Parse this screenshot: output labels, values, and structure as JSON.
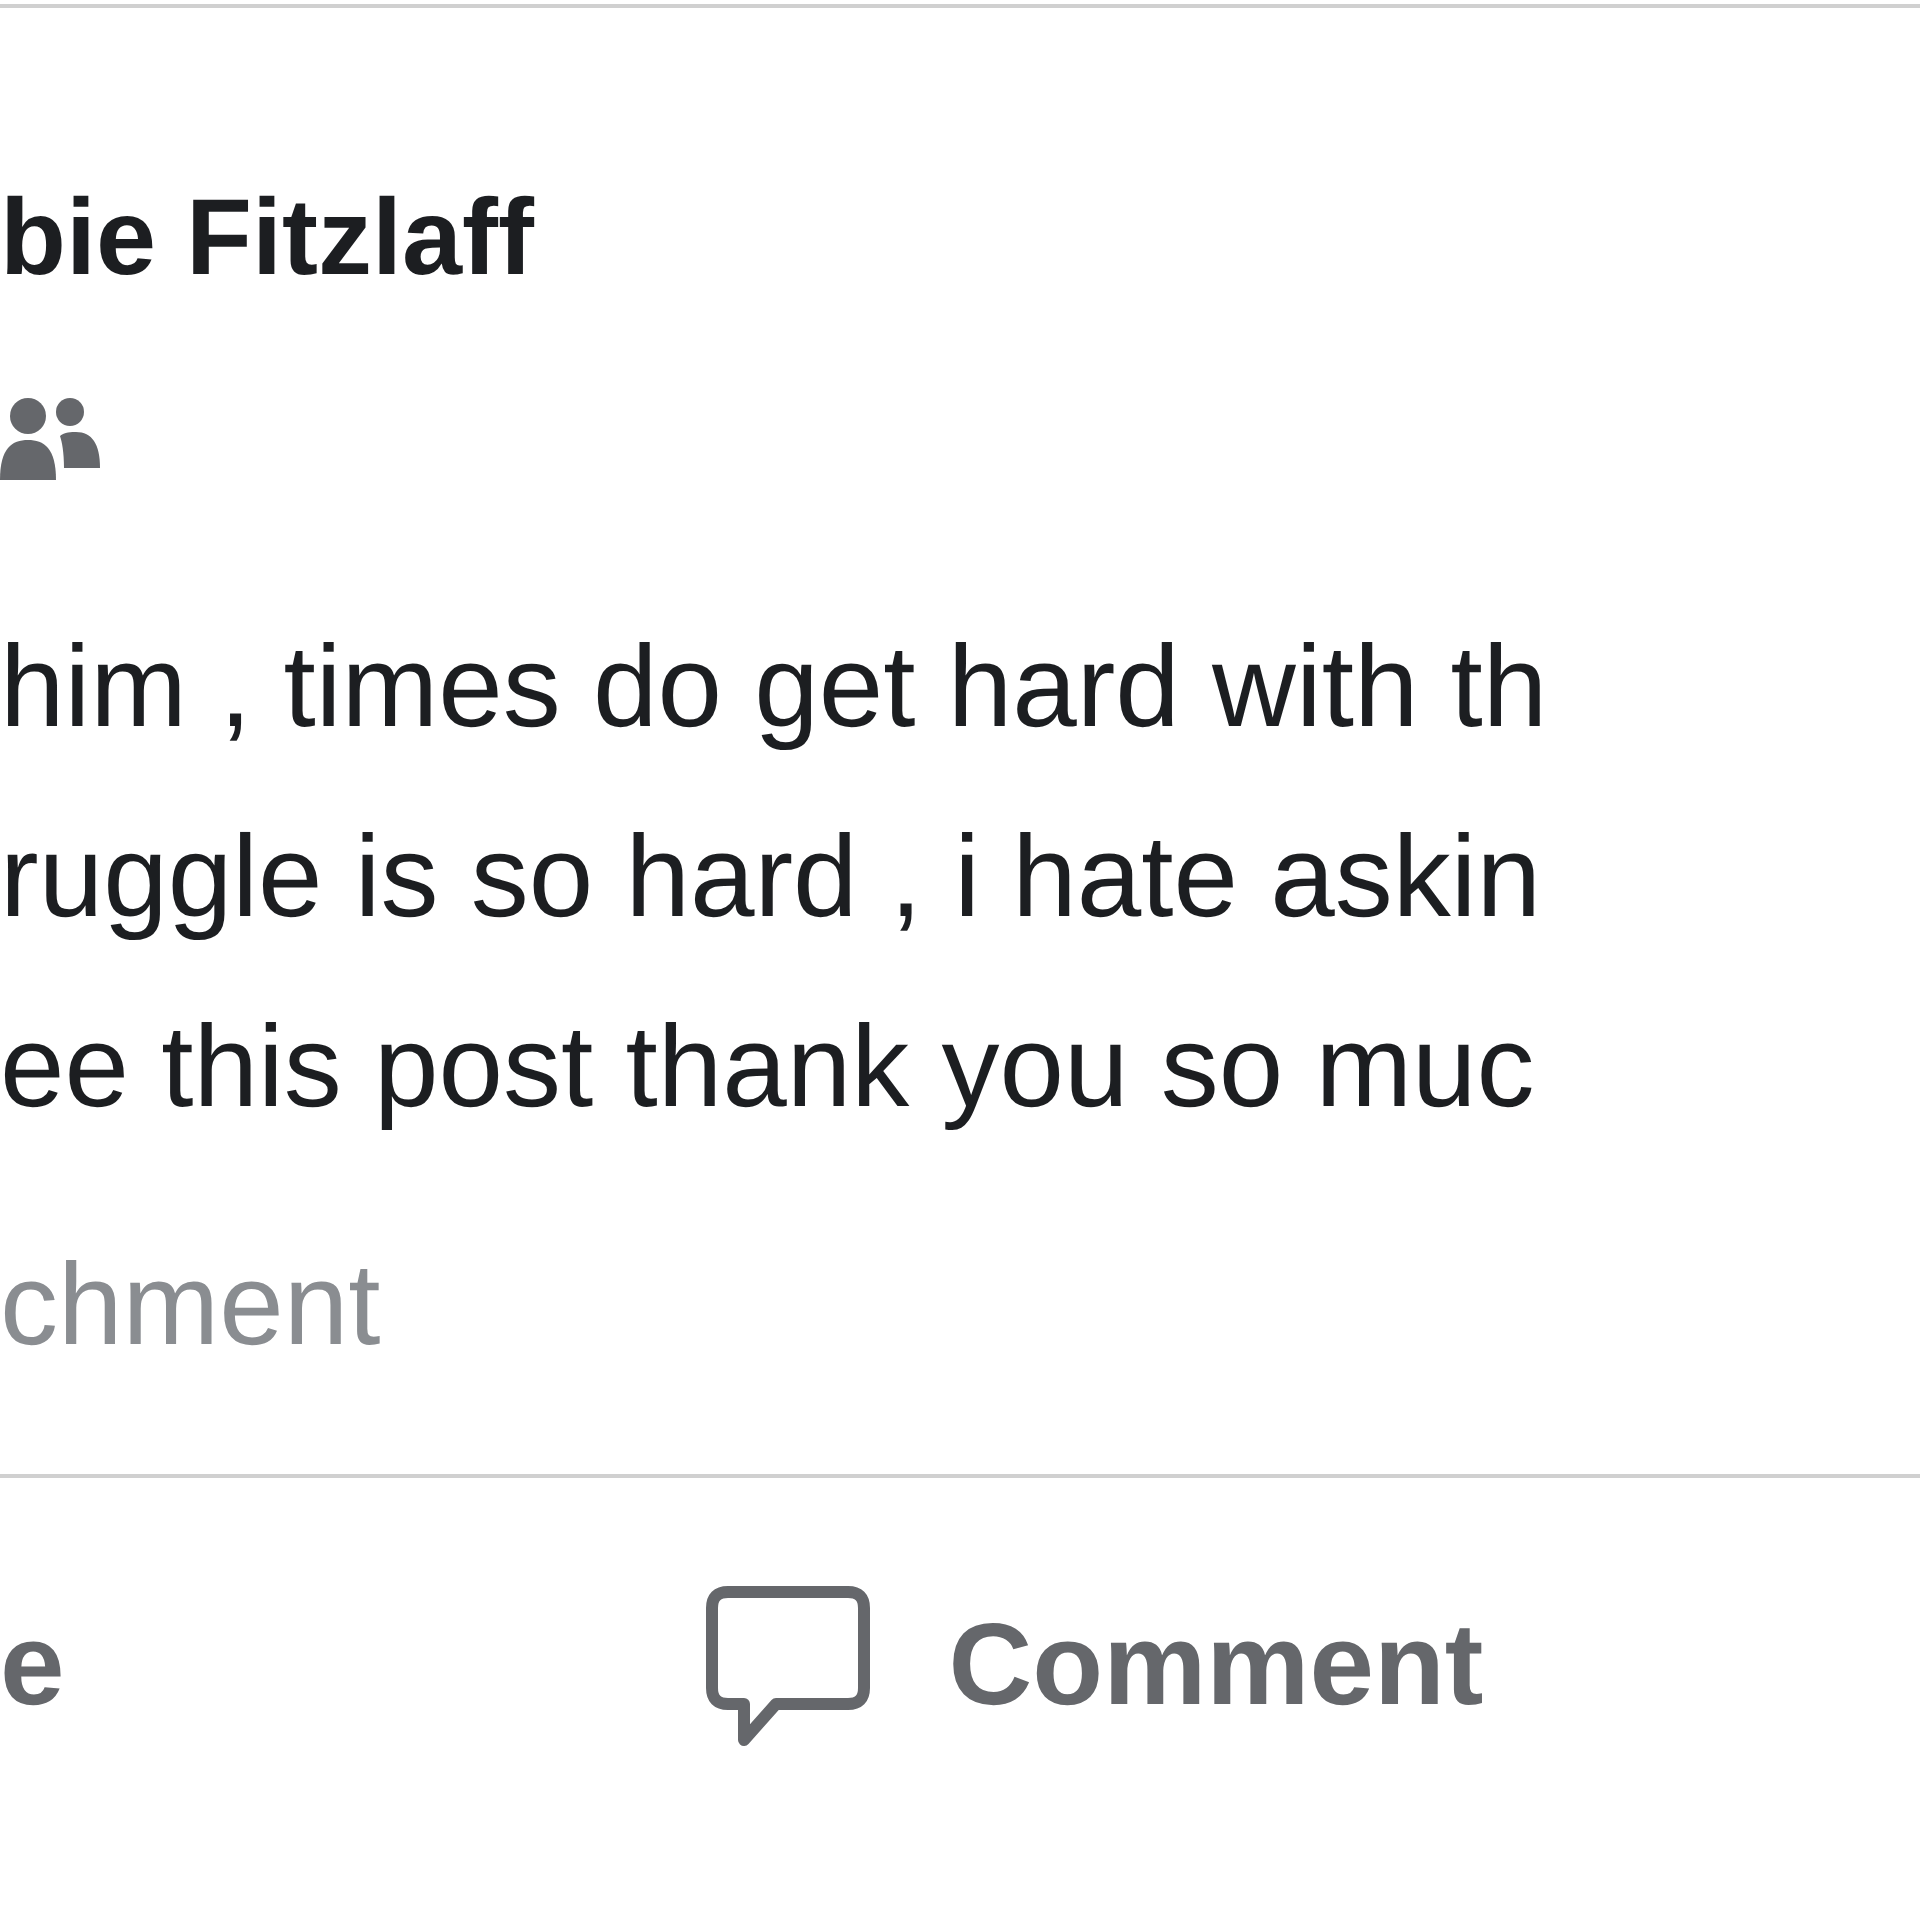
{
  "post": {
    "author": "bie Fitzlaff",
    "body_lines": [
      "him , times do get hard with th",
      "ruggle is so hard , i hate askin",
      "ee this post thank you so muc"
    ],
    "attachment": "chment"
  },
  "actions": [
    {
      "label": "e",
      "kind": "text"
    },
    {
      "label": "Comment",
      "kind": "comment"
    }
  ]
}
